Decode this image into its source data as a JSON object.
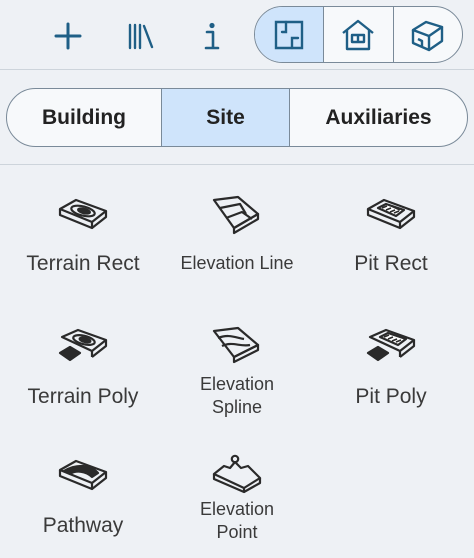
{
  "toolbar": {
    "buttons": [
      {
        "icon": "plus-icon"
      },
      {
        "icon": "library-icon"
      },
      {
        "icon": "info-icon"
      }
    ],
    "views": [
      {
        "icon": "floor-plan-icon",
        "active": true
      },
      {
        "icon": "house-elevation-icon",
        "active": false
      },
      {
        "icon": "house-3d-icon",
        "active": false
      }
    ]
  },
  "tabs": [
    {
      "label": "Building",
      "active": false
    },
    {
      "label": "Site",
      "active": true
    },
    {
      "label": "Auxiliaries",
      "active": false
    }
  ],
  "tools": [
    {
      "label": "Terrain Rect",
      "icon": "terrain-rect-icon"
    },
    {
      "label": "Elevation Line",
      "icon": "elevation-line-icon"
    },
    {
      "label": "Pit Rect",
      "icon": "pit-rect-icon"
    },
    {
      "label": "Terrain Poly",
      "icon": "terrain-poly-icon"
    },
    {
      "label_lines": [
        "Elevation",
        "Spline"
      ],
      "icon": "elevation-spline-icon"
    },
    {
      "label": "Pit Poly",
      "icon": "pit-poly-icon"
    },
    {
      "label": "Pathway",
      "icon": "pathway-icon"
    },
    {
      "label_lines": [
        "Elevation",
        "Point"
      ],
      "icon": "elevation-point-icon"
    }
  ],
  "colors": {
    "accent": "#1f5f86",
    "active_bg": "#cfe4fb",
    "border": "#7a8a99",
    "background": "#eef1f5"
  }
}
